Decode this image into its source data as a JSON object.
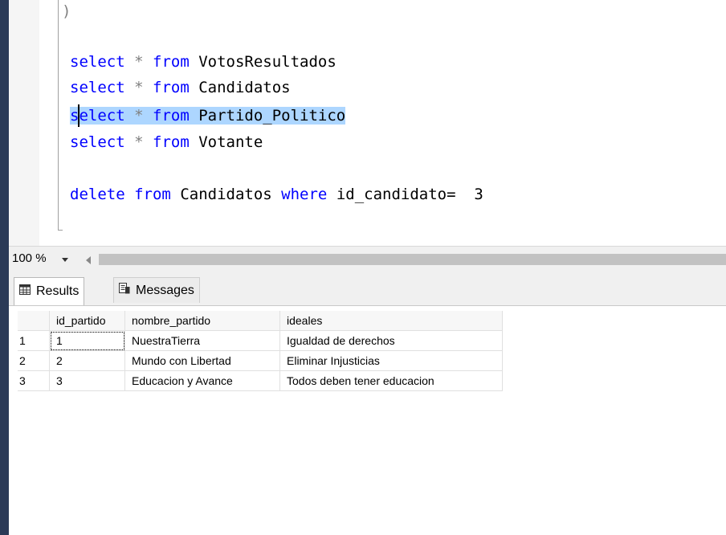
{
  "editor": {
    "code_lines": [
      {
        "kw1": "select",
        "op": "*",
        "kw2": "from",
        "table": "VotosResultados"
      },
      {
        "kw1": "select",
        "op": "*",
        "kw2": "from",
        "table": "Candidatos"
      },
      {
        "kw1": "select",
        "op": "*",
        "kw2": "from",
        "table": "Partido_Politico"
      },
      {
        "kw1": "select",
        "op": "*",
        "kw2": "from",
        "table": "Votante"
      }
    ],
    "fold_end_char": ")",
    "delete_line": {
      "kw1": "delete",
      "kw2": "from",
      "table": "Candidatos",
      "kw3": "where",
      "column": "id_candidato=",
      "value": "3"
    }
  },
  "zoom": {
    "value": "100 %"
  },
  "results_tabs": [
    {
      "label": "Results",
      "icon": "grid-icon"
    },
    {
      "label": "Messages",
      "icon": "messages-icon"
    }
  ],
  "results_grid": {
    "columns": [
      "id_partido",
      "nombre_partido",
      "ideales"
    ],
    "rows": [
      {
        "rownum": "1",
        "cells": [
          "1",
          "NuestraTierra",
          "Igualdad de derechos"
        ]
      },
      {
        "rownum": "2",
        "cells": [
          "2",
          "Mundo con Libertad",
          "Eliminar Injusticias"
        ]
      },
      {
        "rownum": "3",
        "cells": [
          "3",
          "Educacion y Avance",
          "Todos deben tener educacion"
        ]
      }
    ]
  },
  "colors": {
    "keyword": "#0000ff",
    "selection": "#add6ff",
    "window_border": "#2b3a57"
  }
}
